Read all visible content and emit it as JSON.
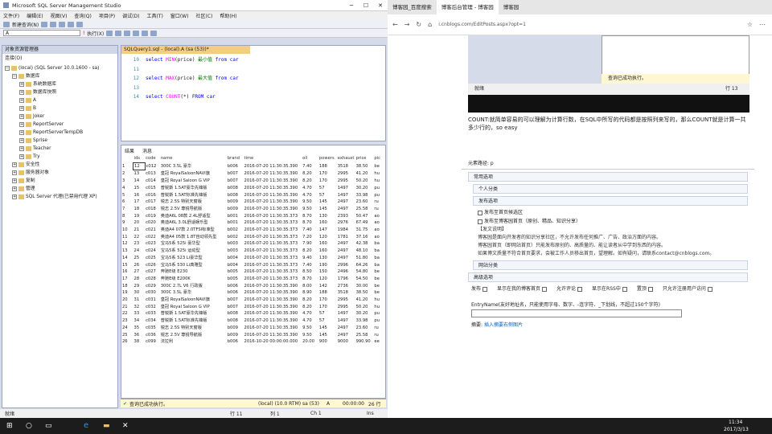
{
  "ssms": {
    "title": "Microsoft SQL Server Management Studio",
    "menu": [
      "文件(F)",
      "编辑(E)",
      "视图(V)",
      "查询(Q)",
      "项目(P)",
      "调试(D)",
      "工具(T)",
      "窗口(W)",
      "社区(C)",
      "帮助(H)"
    ],
    "toolbar": {
      "new_query": "新建查询(N)",
      "db": "A",
      "execute": "执行(X)"
    },
    "explorer": {
      "title": "对象资源管理器",
      "connect": "连接(O)",
      "tree": [
        {
          "t": "(local) (SQL Server 10.0.1600 - sa)",
          "d": 0
        },
        {
          "t": "数据库",
          "d": 1
        },
        {
          "t": "系统数据库",
          "d": 2
        },
        {
          "t": "数据库快照",
          "d": 2
        },
        {
          "t": "A",
          "d": 2
        },
        {
          "t": "B",
          "d": 2
        },
        {
          "t": "Joker",
          "d": 2
        },
        {
          "t": "ReportServer",
          "d": 2
        },
        {
          "t": "ReportServerTempDB",
          "d": 2
        },
        {
          "t": "Sprise",
          "d": 2
        },
        {
          "t": "Teacher",
          "d": 2
        },
        {
          "t": "Try",
          "d": 2
        },
        {
          "t": "安全性",
          "d": 1
        },
        {
          "t": "服务器对象",
          "d": 1
        },
        {
          "t": "复制",
          "d": 1
        },
        {
          "t": "管理",
          "d": 1
        },
        {
          "t": "SQL Server 代理(已禁用代理 XP)",
          "d": 1
        }
      ]
    },
    "editor_tab": "SQLQuery1.sql - (local).A (sa (53))*",
    "code": [
      {
        "n": "10",
        "a": "select ",
        "b": "MIN",
        "c": "(price)",
        "d": " 最小值 ",
        "e": "from car"
      },
      {
        "n": "11",
        "a": "",
        "b": "",
        "c": "",
        "d": "",
        "e": ""
      },
      {
        "n": "12",
        "a": "select ",
        "b": "MAX",
        "c": "(price)",
        "d": " 最大值 ",
        "e": "from car"
      },
      {
        "n": "13",
        "a": "",
        "b": "",
        "c": "",
        "d": "",
        "e": ""
      },
      {
        "n": "14",
        "a": "select ",
        "b": "COUNT",
        "c": "(*)",
        "d": " FROM ",
        "e": "car"
      }
    ],
    "result_tabs": {
      "results": "结果",
      "messages": "消息"
    },
    "columns": [
      "ids",
      "code",
      "name",
      "brand",
      "time",
      "oil",
      "powers",
      "exhaust",
      "price",
      "pic"
    ],
    "rows": [
      [
        "1",
        "12",
        "c012",
        "300C 3.5L 豪华",
        "b006",
        "2016-07-20 11:30:35.390",
        "7.40",
        "188",
        "3518",
        "38.50",
        "be"
      ],
      [
        "2",
        "13",
        "c013",
        "皇冠 RoyalSaloonNAVI旗",
        "b007",
        "2016-07-20 11:30:35.390",
        "8.20",
        "170",
        "2995",
        "41.20",
        "hu"
      ],
      [
        "3",
        "14",
        "c014",
        "皇冠 Royal Saloon G VIP",
        "b007",
        "2016-07-20 11:30:35.390",
        "8.20",
        "170",
        "2995",
        "50.20",
        "hu"
      ],
      [
        "4",
        "15",
        "c015",
        "普锐斯 1.5AT豪华先锋版",
        "b008",
        "2016-07-20 11:30:35.390",
        "4.70",
        "57",
        "1497",
        "30.20",
        "pu"
      ],
      [
        "5",
        "16",
        "c016",
        "普锐斯 1.5AT标准先锋版",
        "b008",
        "2016-07-20 11:30:35.390",
        "4.70",
        "57",
        "1497",
        "33.98",
        "pu"
      ],
      [
        "6",
        "17",
        "c017",
        "锐志 2.5S 特别天窗版",
        "b009",
        "2016-07-20 11:30:35.390",
        "9.50",
        "145",
        "2497",
        "23.60",
        "ru"
      ],
      [
        "7",
        "18",
        "c018",
        "锐志 2.5V 尊锐导航版",
        "b009",
        "2016-07-20 11:30:35.390",
        "9.50",
        "145",
        "2497",
        "25.58",
        "ru"
      ],
      [
        "8",
        "19",
        "c019",
        "奥迪A6L 08款 2.4L舒适型",
        "b001",
        "2016-07-20 11:30:35.373",
        "8.70",
        "130",
        "2393",
        "50.47",
        "ao"
      ],
      [
        "9",
        "20",
        "c020",
        "奥迪A6L 3.0L舒适娱乐型",
        "b001",
        "2016-07-20 11:30:35.373",
        "8.70",
        "160",
        "2976",
        "67.49",
        "ao"
      ],
      [
        "10",
        "21",
        "c021",
        "奥迪A4 07款 2.0TFSI标准型",
        "b002",
        "2016-07-20 11:30:35.373",
        "7.40",
        "147",
        "1984",
        "31.75",
        "ao"
      ],
      [
        "11",
        "22",
        "c022",
        "奥迪A4 05款 1.8T自动领先型",
        "b002",
        "2016-07-20 11:30:35.373",
        "7.20",
        "120",
        "1781",
        "37.16",
        "ao"
      ],
      [
        "12",
        "23",
        "c023",
        "宝马5系 525i 豪华型",
        "b003",
        "2016-07-20 11:30:35.373",
        "7.90",
        "160",
        "2497",
        "42.38",
        "ba"
      ],
      [
        "13",
        "24",
        "c024",
        "宝马5系 525i 运动型",
        "b003",
        "2016-07-20 11:30:35.373",
        "8.20",
        "160",
        "2497",
        "48.10",
        "ba"
      ],
      [
        "14",
        "25",
        "c025",
        "宝马5系 523 Li豪华型",
        "b004",
        "2016-07-20 11:30:35.373",
        "9.40",
        "130",
        "2497",
        "51.80",
        "ba"
      ],
      [
        "15",
        "26",
        "c026",
        "宝马5系 530 Li典雅型",
        "b004",
        "2016-07-20 11:30:35.373",
        "7.40",
        "190",
        "2996",
        "64.26",
        "ba"
      ],
      [
        "16",
        "27",
        "c027",
        "奔驰E级 E230",
        "b005",
        "2016-07-20 11:30:35.373",
        "8.50",
        "150",
        "2496",
        "54.80",
        "be"
      ],
      [
        "17",
        "28",
        "c028",
        "奔驰E级 E200K",
        "b005",
        "2016-07-20 11:30:35.373",
        "8.70",
        "120",
        "1796",
        "54.50",
        "be"
      ],
      [
        "18",
        "29",
        "c029",
        "300C 2.7L V6 行政版",
        "b006",
        "2016-07-20 11:30:35.390",
        "8.00",
        "142",
        "2736",
        "30.00",
        "be"
      ],
      [
        "19",
        "30",
        "c030",
        "300C 3.5L 豪华",
        "b006",
        "2016-07-20 11:30:35.390",
        "8.90",
        "188",
        "3518",
        "38.50",
        "be"
      ],
      [
        "20",
        "31",
        "c031",
        "皇冠 RoyalSaloonNAVI旗",
        "b007",
        "2016-07-20 11:30:35.390",
        "8.20",
        "170",
        "2995",
        "41.20",
        "hu"
      ],
      [
        "21",
        "32",
        "c032",
        "皇冠 Royal Saloon G VIP",
        "b007",
        "2016-07-20 11:30:35.390",
        "8.20",
        "170",
        "2995",
        "50.20",
        "hu"
      ],
      [
        "22",
        "33",
        "c033",
        "普锐斯 1.5AT豪华先锋版",
        "b008",
        "2016-07-20 11:30:35.390",
        "4.70",
        "57",
        "1497",
        "30.20",
        "pu"
      ],
      [
        "23",
        "34",
        "c034",
        "普锐斯 1.5AT标准先锋版",
        "b008",
        "2016-07-20 11:30:35.390",
        "4.70",
        "57",
        "1497",
        "33.98",
        "pu"
      ],
      [
        "24",
        "35",
        "c035",
        "锐志 2.5S 特别天窗版",
        "b009",
        "2016-07-20 11:30:35.390",
        "9.50",
        "145",
        "2497",
        "23.60",
        "ru"
      ],
      [
        "25",
        "36",
        "c036",
        "锐志 2.5V 尊锐导航版",
        "b009",
        "2016-07-20 11:30:35.390",
        "9.50",
        "145",
        "2497",
        "25.58",
        "ru"
      ],
      [
        "26",
        "38",
        "c099",
        "法拉利",
        "b006",
        "2016-10-20 00:00:00.000",
        "20.00",
        "900",
        "9000",
        "990.90",
        "ee"
      ]
    ],
    "status": {
      "msg": "查询已成功执行。",
      "server": "(local) (10.0 RTM)",
      "user": "sa (53)",
      "db": "A",
      "time": "00:00:00",
      "rows": "26 行"
    },
    "bottom": {
      "ready": "就绪",
      "row": "行 11",
      "col": "列 1",
      "ch": "Ch 1",
      "ins": "Ins"
    }
  },
  "browser": {
    "tabs": [
      "博客园_百度搜索",
      "博客后台管理 - 博客园",
      "博客园"
    ],
    "url": "i.cnblogs.com/EditPosts.aspx?opt=1",
    "embedded": {
      "ready": "就绪",
      "row": "行 13",
      "success": "查询已成功执行。"
    },
    "body_text": "COUNT:就简单容易的可以理解为计算行数，在SQL中所写的代码都是按照列来写的，那么COUNT就是计算一共多少行的，so easy",
    "path": "元素路径: p",
    "common": "常用选项",
    "personal": "个人分类",
    "publish": "发布选项",
    "publish_opts": [
      "发布至首页候选区",
      "发布至博客园首页（原创、精品、知识分享）"
    ],
    "notes_title": "【发文说明】",
    "notes": [
      "博客园是面向开发者的知识分享社区，不允许发布任何推广、广告、政治方面的内容。",
      "博客园首页（即网站首页）只能发布原创的、高质量的、能让读者从中学到东西的内容。",
      "如果博文质量不符合首页要求，会被工作人员移出首页，望理解。如有疑问，请联系contact@cnblogs.com。"
    ],
    "category": "网站分类",
    "advanced": "高级选项",
    "adv_opts": [
      "发布",
      "显示在我的博客首页",
      "允许评论",
      "显示在RSS中",
      "置顶",
      "只允许注册用户访问"
    ],
    "entry_label": "EntryName(友好地址名，只能使用字母、数字、-连字符、_下划线，不超过150个字符)",
    "summary": "摘要:",
    "summary_link": "插入摘要右侧图片"
  },
  "taskbar": {
    "time": "11:34",
    "date": "2017/3/13"
  }
}
